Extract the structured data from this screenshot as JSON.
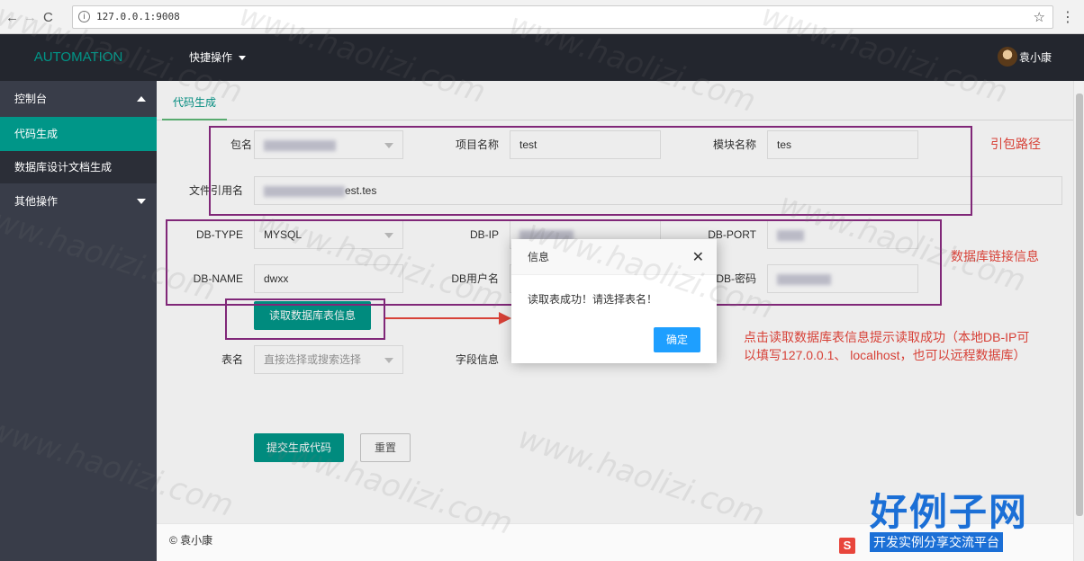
{
  "browser": {
    "url": "127.0.0.1:9008",
    "info_glyph": "i",
    "back_glyph": "←",
    "forward_glyph": "→",
    "reload_glyph": "C",
    "star_glyph": "☆",
    "menu_glyph": "⋮"
  },
  "topbar": {
    "brand": "AUTOMATION",
    "quick_menu": "快捷操作",
    "user_name": "袁小康"
  },
  "sidebar": {
    "items": [
      {
        "label": "控制台"
      },
      {
        "label": "代码生成"
      },
      {
        "label": "数据库设计文档生成"
      },
      {
        "label": "其他操作"
      }
    ]
  },
  "main": {
    "tab": "代码生成",
    "form": {
      "package_label": "包名",
      "project_label": "项目名称",
      "project_value": "test",
      "module_label": "模块名称",
      "module_value": "tes",
      "file_ref_label": "文件引用名",
      "file_ref_value": "est.tes",
      "db_type_label": "DB-TYPE",
      "db_type_value": "MYSQL",
      "db_ip_label": "DB-IP",
      "db_port_label": "DB-PORT",
      "db_name_label": "DB-NAME",
      "db_name_value": "dwxx",
      "db_user_label": "DB用户名",
      "db_password_label": "DB-密码",
      "read_button": "读取数据库表信息",
      "table_label": "表名",
      "table_placeholder": "直接选择或搜索选择",
      "field_info_label": "字段信息",
      "submit_button": "提交生成代码",
      "reset_button": "重置"
    }
  },
  "annotations": {
    "package_path": "引包路径",
    "db_connection": "数据库链接信息",
    "read_note_line1": "点击读取数据库表信息提示读取成功（本地DB-IP可",
    "read_note_line2": "以填写127.0.0.1、 localhost，也可以远程数据库）"
  },
  "dialog": {
    "title": "信息",
    "message": "读取表成功！请选择表名！",
    "ok": "确定",
    "close_glyph": "✕"
  },
  "footer": {
    "copyright": "© 袁小康"
  },
  "watermark": {
    "text": "www.haolizi.com",
    "logo_big": "好例子网",
    "logo_small": "开发实例分享交流平台",
    "s_icon": "S"
  },
  "colors": {
    "accent": "#009688",
    "topbar": "#23262e",
    "sidebar": "#393d49",
    "annotation": "#e8463c",
    "box": "#8a2a82",
    "dialog_ok": "#1e9fff"
  }
}
